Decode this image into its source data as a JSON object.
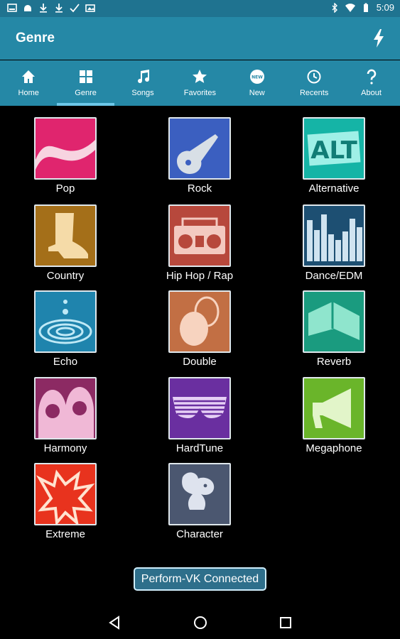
{
  "status_bar": {
    "time": "5:09"
  },
  "app_bar": {
    "title": "Genre"
  },
  "tabs": [
    {
      "label": "Home"
    },
    {
      "label": "Genre"
    },
    {
      "label": "Songs"
    },
    {
      "label": "Favorites"
    },
    {
      "label": "New"
    },
    {
      "label": "Recents"
    },
    {
      "label": "About"
    }
  ],
  "genres": [
    {
      "label": "Pop"
    },
    {
      "label": "Rock"
    },
    {
      "label": "Alternative"
    },
    {
      "label": "Country"
    },
    {
      "label": "Hip Hop / Rap"
    },
    {
      "label": "Dance/EDM"
    },
    {
      "label": "Echo"
    },
    {
      "label": "Double"
    },
    {
      "label": "Reverb"
    },
    {
      "label": "Harmony"
    },
    {
      "label": "HardTune"
    },
    {
      "label": "Megaphone"
    },
    {
      "label": "Extreme"
    },
    {
      "label": "Character"
    }
  ],
  "device_button": {
    "label": "Perform-VK Connected"
  },
  "icons": {
    "tab_icons": [
      "home-icon",
      "grid-icon",
      "music-note-icon",
      "star-icon",
      "new-badge-icon",
      "clock-icon",
      "question-icon"
    ],
    "status_icons": [
      "image-icon",
      "android-icon",
      "download-icon",
      "download-icon",
      "check-icon",
      "gallery-icon",
      "bluetooth-icon",
      "wifi-icon",
      "battery-icon"
    ]
  },
  "colors": {
    "status_bar": "#1f7390",
    "app_bar": "#2588a6",
    "tab_indicator": "#6cc7e8"
  }
}
